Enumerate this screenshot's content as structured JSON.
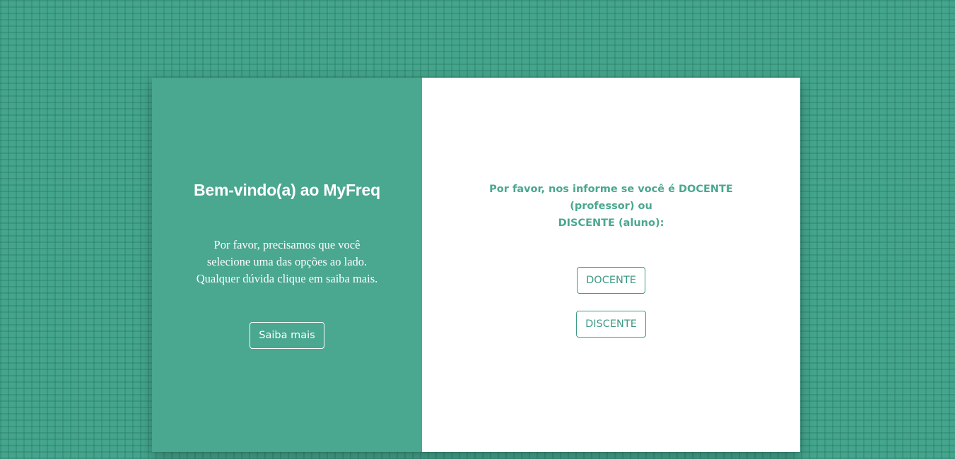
{
  "colors": {
    "background": "#44a48c",
    "left_panel": "#4aa790",
    "accent": "#3f9a84",
    "right_panel": "#ffffff"
  },
  "left_panel": {
    "title": "Bem-vindo(a) ao MyFreq",
    "text_lines": [
      "Por favor, precisamos que você",
      "selecione uma das opções ao lado.",
      "Qualquer dúvida clique em saiba mais."
    ],
    "info_button_label": "Saiba mais"
  },
  "right_panel": {
    "prompt_lines": [
      "Por favor, nos informe se você é DOCENTE (professor) ou",
      "DISCENTE (aluno):"
    ],
    "buttons": [
      {
        "label": "DOCENTE"
      },
      {
        "label": "DISCENTE"
      }
    ]
  }
}
